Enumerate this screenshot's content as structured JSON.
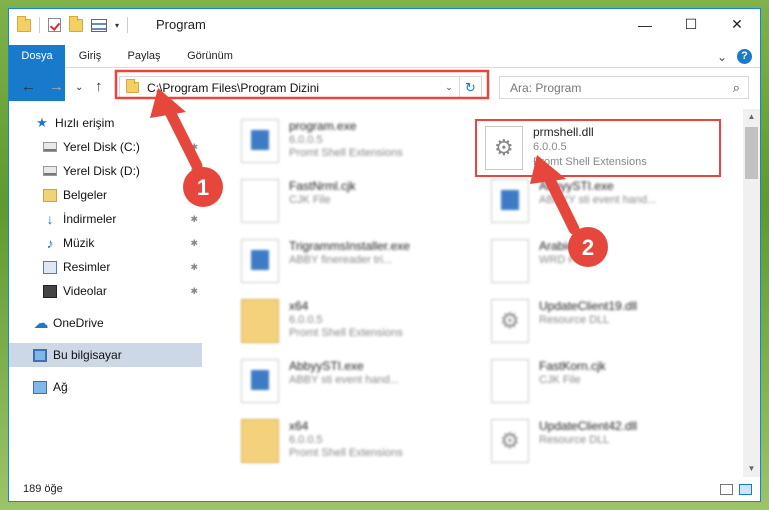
{
  "title_bar": {
    "title": "Program",
    "minimize": "—",
    "maximize": "☐",
    "close": "✕"
  },
  "ribbon": {
    "tabs": [
      "Dosya",
      "Giriş",
      "Paylaş",
      "Görünüm"
    ],
    "expand": "⌄",
    "help": "?"
  },
  "nav": {
    "back": "←",
    "forward": "→",
    "recent": "⌄",
    "up": "↑",
    "address": "C:\\Program Files\\Program Dizini",
    "address_caret": "⌄",
    "refresh": "↻",
    "search_placeholder": "Ara: Program",
    "search_icon": "⌕"
  },
  "sidebar": {
    "items": [
      {
        "label": "Hızlı erişim",
        "icon": "star-icon"
      },
      {
        "label": "Yerel Disk (C:)",
        "icon": "disk-icon",
        "pinned": true
      },
      {
        "label": "Yerel Disk (D:)",
        "icon": "disk-icon",
        "pinned": true
      },
      {
        "label": "Belgeler",
        "icon": "documents-icon",
        "pinned": true
      },
      {
        "label": "İndirmeler",
        "icon": "download-icon",
        "pinned": true
      },
      {
        "label": "Müzik",
        "icon": "music-icon",
        "pinned": true
      },
      {
        "label": "Resimler",
        "icon": "pictures-icon",
        "pinned": true
      },
      {
        "label": "Videolar",
        "icon": "video-icon",
        "pinned": true
      },
      {
        "label": "OneDrive",
        "icon": "cloud-icon"
      },
      {
        "label": "Bu bilgisayar",
        "icon": "pc-icon",
        "selected": true
      },
      {
        "label": "Ağ",
        "icon": "network-icon"
      }
    ],
    "pin_glyph": "📌"
  },
  "files": [
    {
      "name": "program.exe",
      "meta1": "6.0.0.5",
      "meta2": "Promt Shell Extensions",
      "icon": "exe-icon"
    },
    {
      "name": "prmshell.dll",
      "meta1": "6.0.0.5",
      "meta2": "Promt Shell Extensions",
      "icon": "dll-icon"
    },
    {
      "name": "FastNrml.cjk",
      "meta1": "CJK File",
      "meta2": "",
      "icon": "file-icon"
    },
    {
      "name": "AbbyySTI.exe",
      "meta1": "ABBYY sti event hand...",
      "meta2": "",
      "icon": "exe-icon"
    },
    {
      "name": "TrigrammsInstaller.exe",
      "meta1": "ABBY finereader tri...",
      "meta2": "",
      "icon": "exe-icon"
    },
    {
      "name": "Arabic",
      "meta1": "WRD File",
      "meta2": "",
      "icon": "file-icon"
    },
    {
      "name": "x64",
      "meta1": "6.0.0.5",
      "meta2": "Promt Shell Extensions",
      "icon": "folder-file-icon"
    },
    {
      "name": "UpdateClient19.dll",
      "meta1": "Resource DLL",
      "meta2": "",
      "icon": "dll-icon"
    },
    {
      "name": "AbbyySTI.exe",
      "meta1": "ABBY sti event hand...",
      "meta2": "",
      "icon": "exe-icon"
    },
    {
      "name": "FastKorn.cjk",
      "meta1": "CJK File",
      "meta2": "",
      "icon": "file-icon"
    },
    {
      "name": "x64",
      "meta1": "6.0.0.5",
      "meta2": "Promt Shell Extensions",
      "icon": "folder-file-icon"
    },
    {
      "name": "UpdateClient42.dll",
      "meta1": "Resource DLL",
      "meta2": "",
      "icon": "dll-icon"
    }
  ],
  "status": {
    "count": "189 öğe"
  },
  "annotations": {
    "step1": "1",
    "step2": "2",
    "color": "#e5473d"
  }
}
